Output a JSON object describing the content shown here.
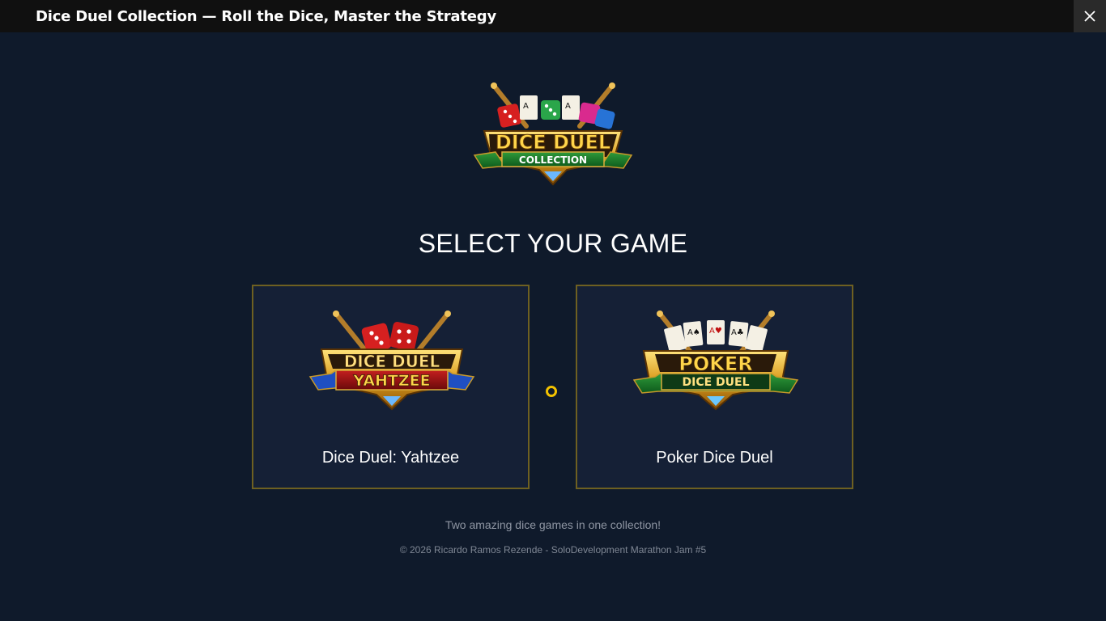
{
  "window": {
    "title": "Dice Duel Collection — Roll the Dice, Master the Strategy"
  },
  "main_logo": {
    "line1": "DICE DUEL",
    "line2": "COLLECTION"
  },
  "heading": "SELECT YOUR GAME",
  "games": [
    {
      "logo_line1": "DICE DUEL",
      "logo_line2": "YAHTZEE",
      "label": "Dice Duel: Yahtzee"
    },
    {
      "logo_line1": "POKER",
      "logo_line2": "DICE DUEL",
      "label": "Poker Dice Duel"
    }
  ],
  "tagline": "Two amazing dice games in one collection!",
  "copyright": "© 2026 Ricardo Ramos Rezende - SoloDevelopment Marathon Jam #5",
  "colors": {
    "background": "#0f1a2b",
    "card_background": "#152036",
    "card_border": "#6e6021",
    "accent_gold": "#f2c200"
  }
}
